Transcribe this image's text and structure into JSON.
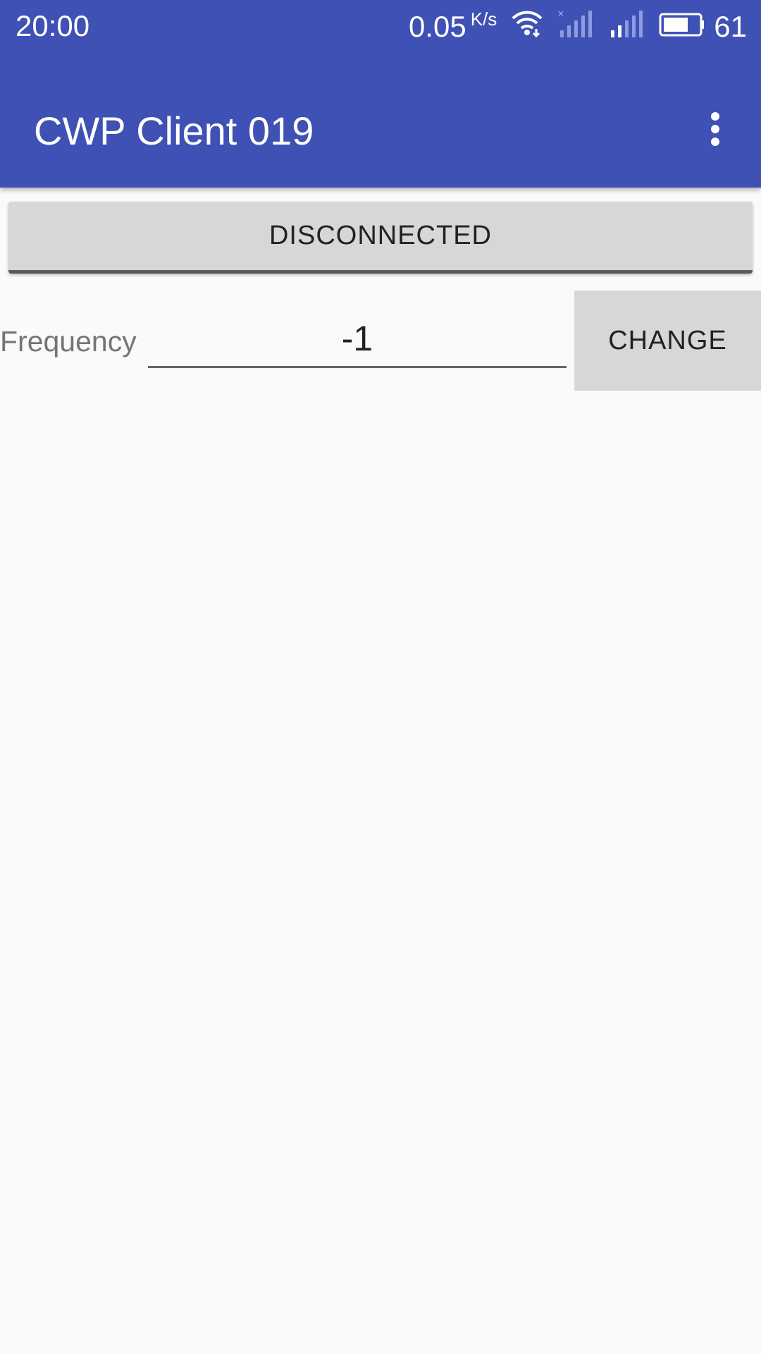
{
  "status_bar": {
    "time": "20:00",
    "net_speed": "0.05",
    "net_speed_unit": "K/s",
    "battery": "61",
    "icons": [
      "wifi-icon",
      "signal-icon-no-service",
      "signal-icon",
      "battery-icon"
    ]
  },
  "app_bar": {
    "title": "CWP Client 019",
    "menu_icon": "overflow-menu-icon"
  },
  "main": {
    "connection_status": "DISCONNECTED",
    "frequency_label": "Frequency",
    "frequency_value": "-1",
    "change_button": "CHANGE"
  },
  "colors": {
    "primary": "#3F51B5",
    "background": "#FAFAFA",
    "button": "#D6D7D7"
  }
}
